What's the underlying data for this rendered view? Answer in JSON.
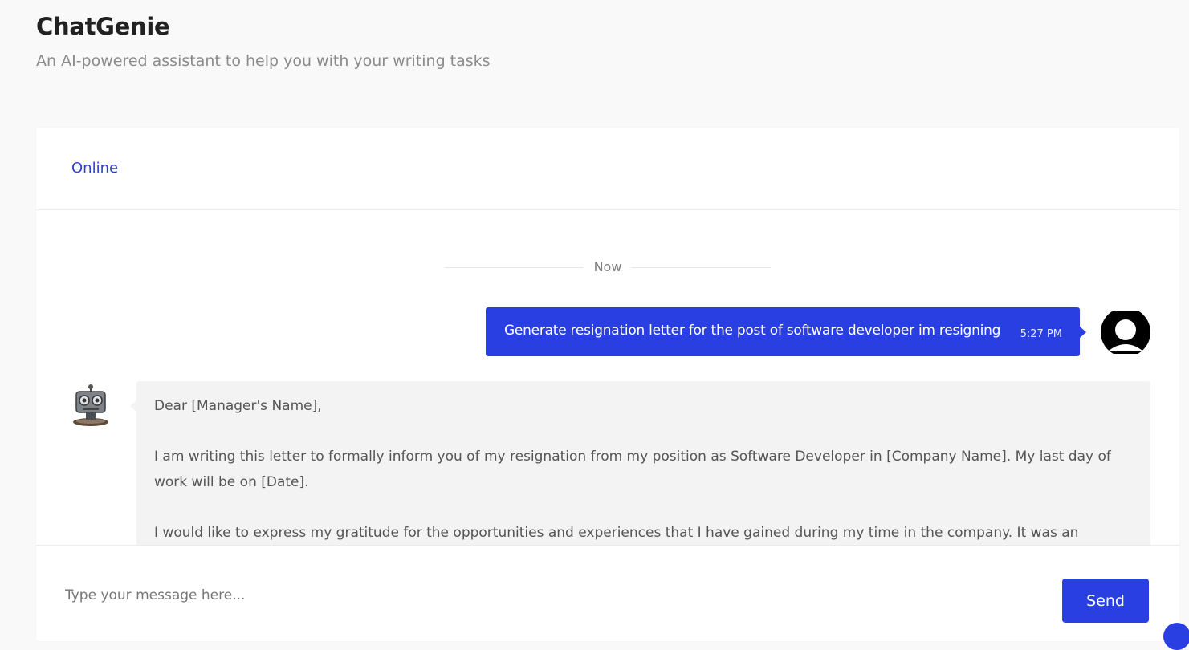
{
  "app": {
    "title": "ChatGenie",
    "subtitle": "An AI-powered assistant to help you with your writing tasks"
  },
  "header": {
    "status": "Online",
    "status_color": "#2c3fd6"
  },
  "chat": {
    "divider_label": "Now",
    "messages": [
      {
        "sender": "user",
        "text": "Generate resignation letter for the post of software developer im resigning",
        "time": "5:27 PM",
        "avatar_icon": "user-avatar-icon"
      },
      {
        "sender": "bot",
        "avatar_icon": "robot-icon",
        "lines": [
          "Dear [Manager's Name],",
          "",
          "I am writing this letter to formally inform you of my resignation from my position as Software Developer in [Company Name]. My last day of work will be on [Date].",
          "",
          "I would like to express my gratitude for the opportunities and experiences that I have gained during my time in the company. It was an incredible"
        ]
      }
    ]
  },
  "composer": {
    "placeholder": "Type your message here...",
    "value": "",
    "send_label": "Send"
  },
  "colors": {
    "accent": "#2a3fe2",
    "page_background": "#f9f9f9",
    "bot_bubble": "#f3f3f3"
  }
}
